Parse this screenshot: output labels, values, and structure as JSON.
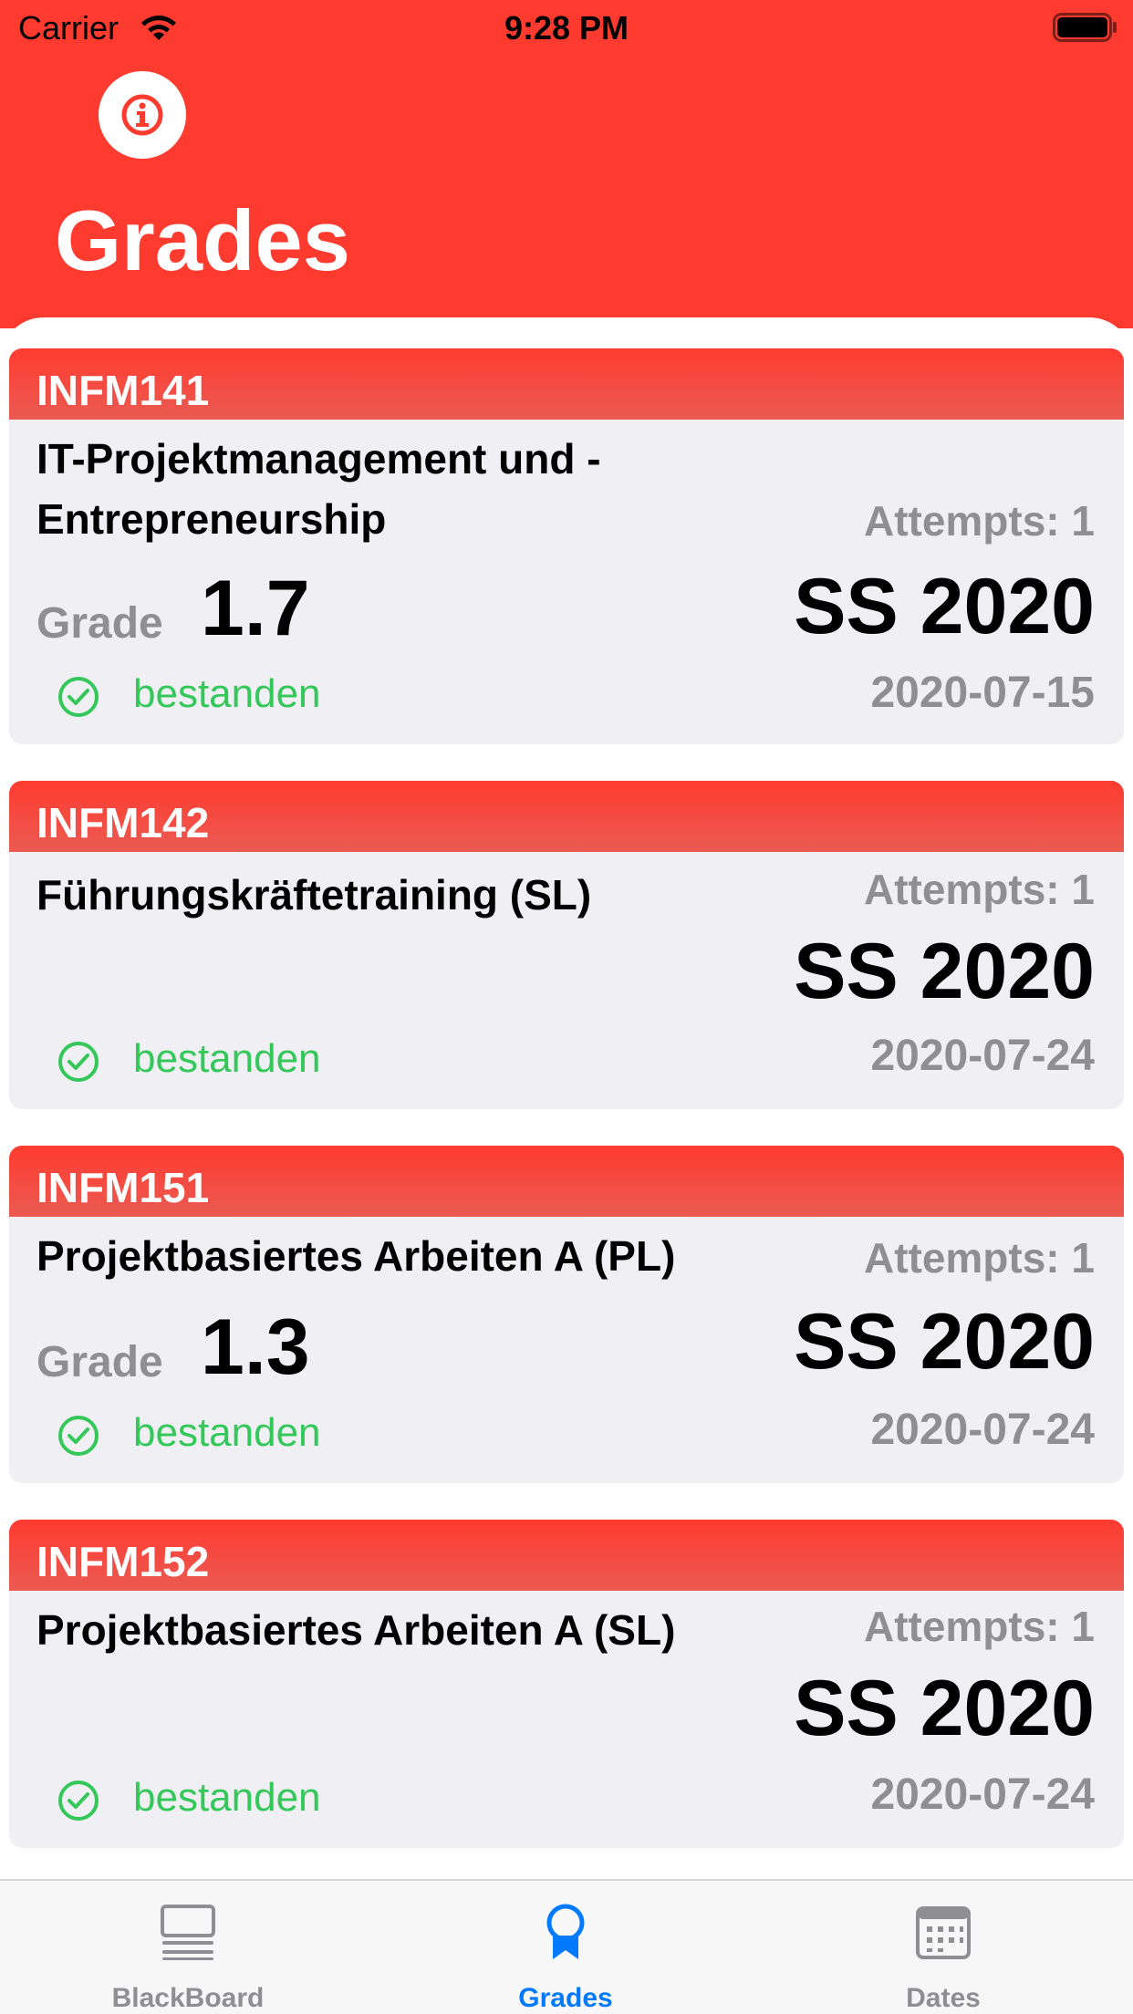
{
  "status_bar": {
    "carrier": "Carrier",
    "time": "9:28 PM"
  },
  "header": {
    "title": "Grades",
    "info_icon": "info-icon"
  },
  "colors": {
    "brand_red": "#ff3b30",
    "passed_green": "#34c759",
    "tab_active": "#007aff",
    "tab_inactive": "#8e8e93"
  },
  "cards": [
    {
      "code": "INFM141",
      "title": "IT-Projektmanagement und -Entrepreneurship",
      "attempts": "Attempts: 1",
      "semester": "SS 2020",
      "grade_label": "Grade",
      "grade": "1.7",
      "status": "bestanden",
      "date": "2020-07-15"
    },
    {
      "code": "INFM142",
      "title": "Führungskräftetraining (SL)",
      "attempts": "Attempts: 1",
      "semester": "SS 2020",
      "status": "bestanden",
      "date": "2020-07-24"
    },
    {
      "code": "INFM151",
      "title": "Projektbasiertes Arbeiten A (PL)",
      "attempts": "Attempts: 1",
      "semester": "SS 2020",
      "grade_label": "Grade",
      "grade": "1.3",
      "status": "bestanden",
      "date": "2020-07-24"
    },
    {
      "code": "INFM152",
      "title": "Projektbasiertes Arbeiten A (SL)",
      "attempts": "Attempts: 1",
      "semester": "SS 2020",
      "status": "bestanden",
      "date": "2020-07-24"
    }
  ],
  "tab_bar": {
    "tabs": [
      {
        "label": "BlackBoard",
        "icon": "blackboard-icon",
        "active": false
      },
      {
        "label": "Grades",
        "icon": "ribbon-icon",
        "active": true
      },
      {
        "label": "Dates",
        "icon": "calendar-icon",
        "active": false
      }
    ]
  }
}
